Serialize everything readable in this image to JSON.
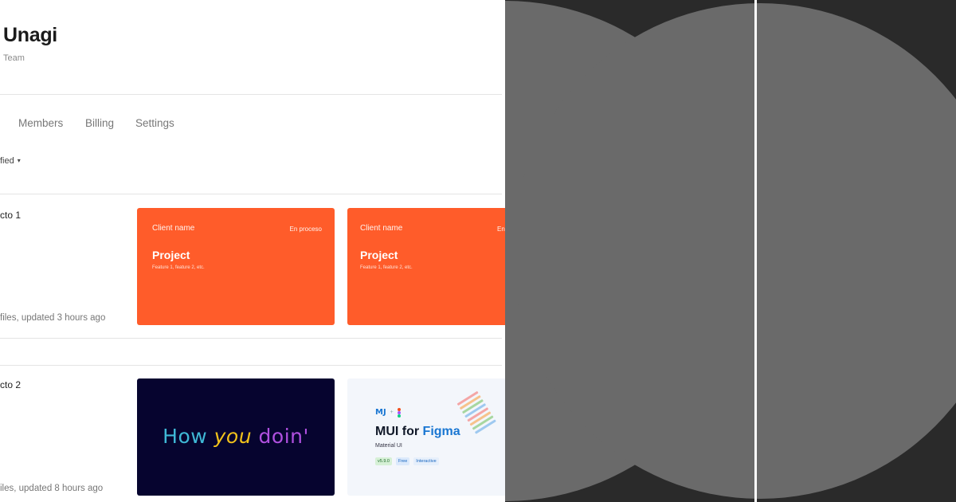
{
  "header": {
    "title": "Unagi",
    "subtitle": "Team"
  },
  "tabs": [
    "Members",
    "Billing",
    "Settings"
  ],
  "filter": {
    "label": "fied"
  },
  "projects": [
    {
      "name": "cto 1",
      "meta": "files, updated 3 hours ago"
    },
    {
      "name": "cto 2",
      "meta": "iles, updated 8 hours ago"
    }
  ],
  "cards": {
    "orange1": {
      "client": "Client name",
      "status": "En proceso",
      "project": "Project",
      "features": "Feature 1, feature 2, etc."
    },
    "orange2": {
      "client": "Client name",
      "status": "En",
      "project": "Project",
      "features": "Feature 1, feature 2, etc."
    },
    "dark": {
      "words": [
        "How",
        "you",
        "doin'"
      ]
    },
    "mui": {
      "logo": "MJ",
      "plus": "+",
      "heading_prefix": "MUI for ",
      "heading_accent": "Figma",
      "subtitle": "Material UI",
      "badges": [
        "v5.9.0",
        "Free",
        "Interactive"
      ]
    }
  },
  "colors": {
    "accent_orange": "#ff5c2a",
    "dark_card": "#06042f",
    "mui_blue": "#1976d2",
    "circle_grey": "#6a6a6a",
    "right_bg": "#2a2a2a"
  }
}
